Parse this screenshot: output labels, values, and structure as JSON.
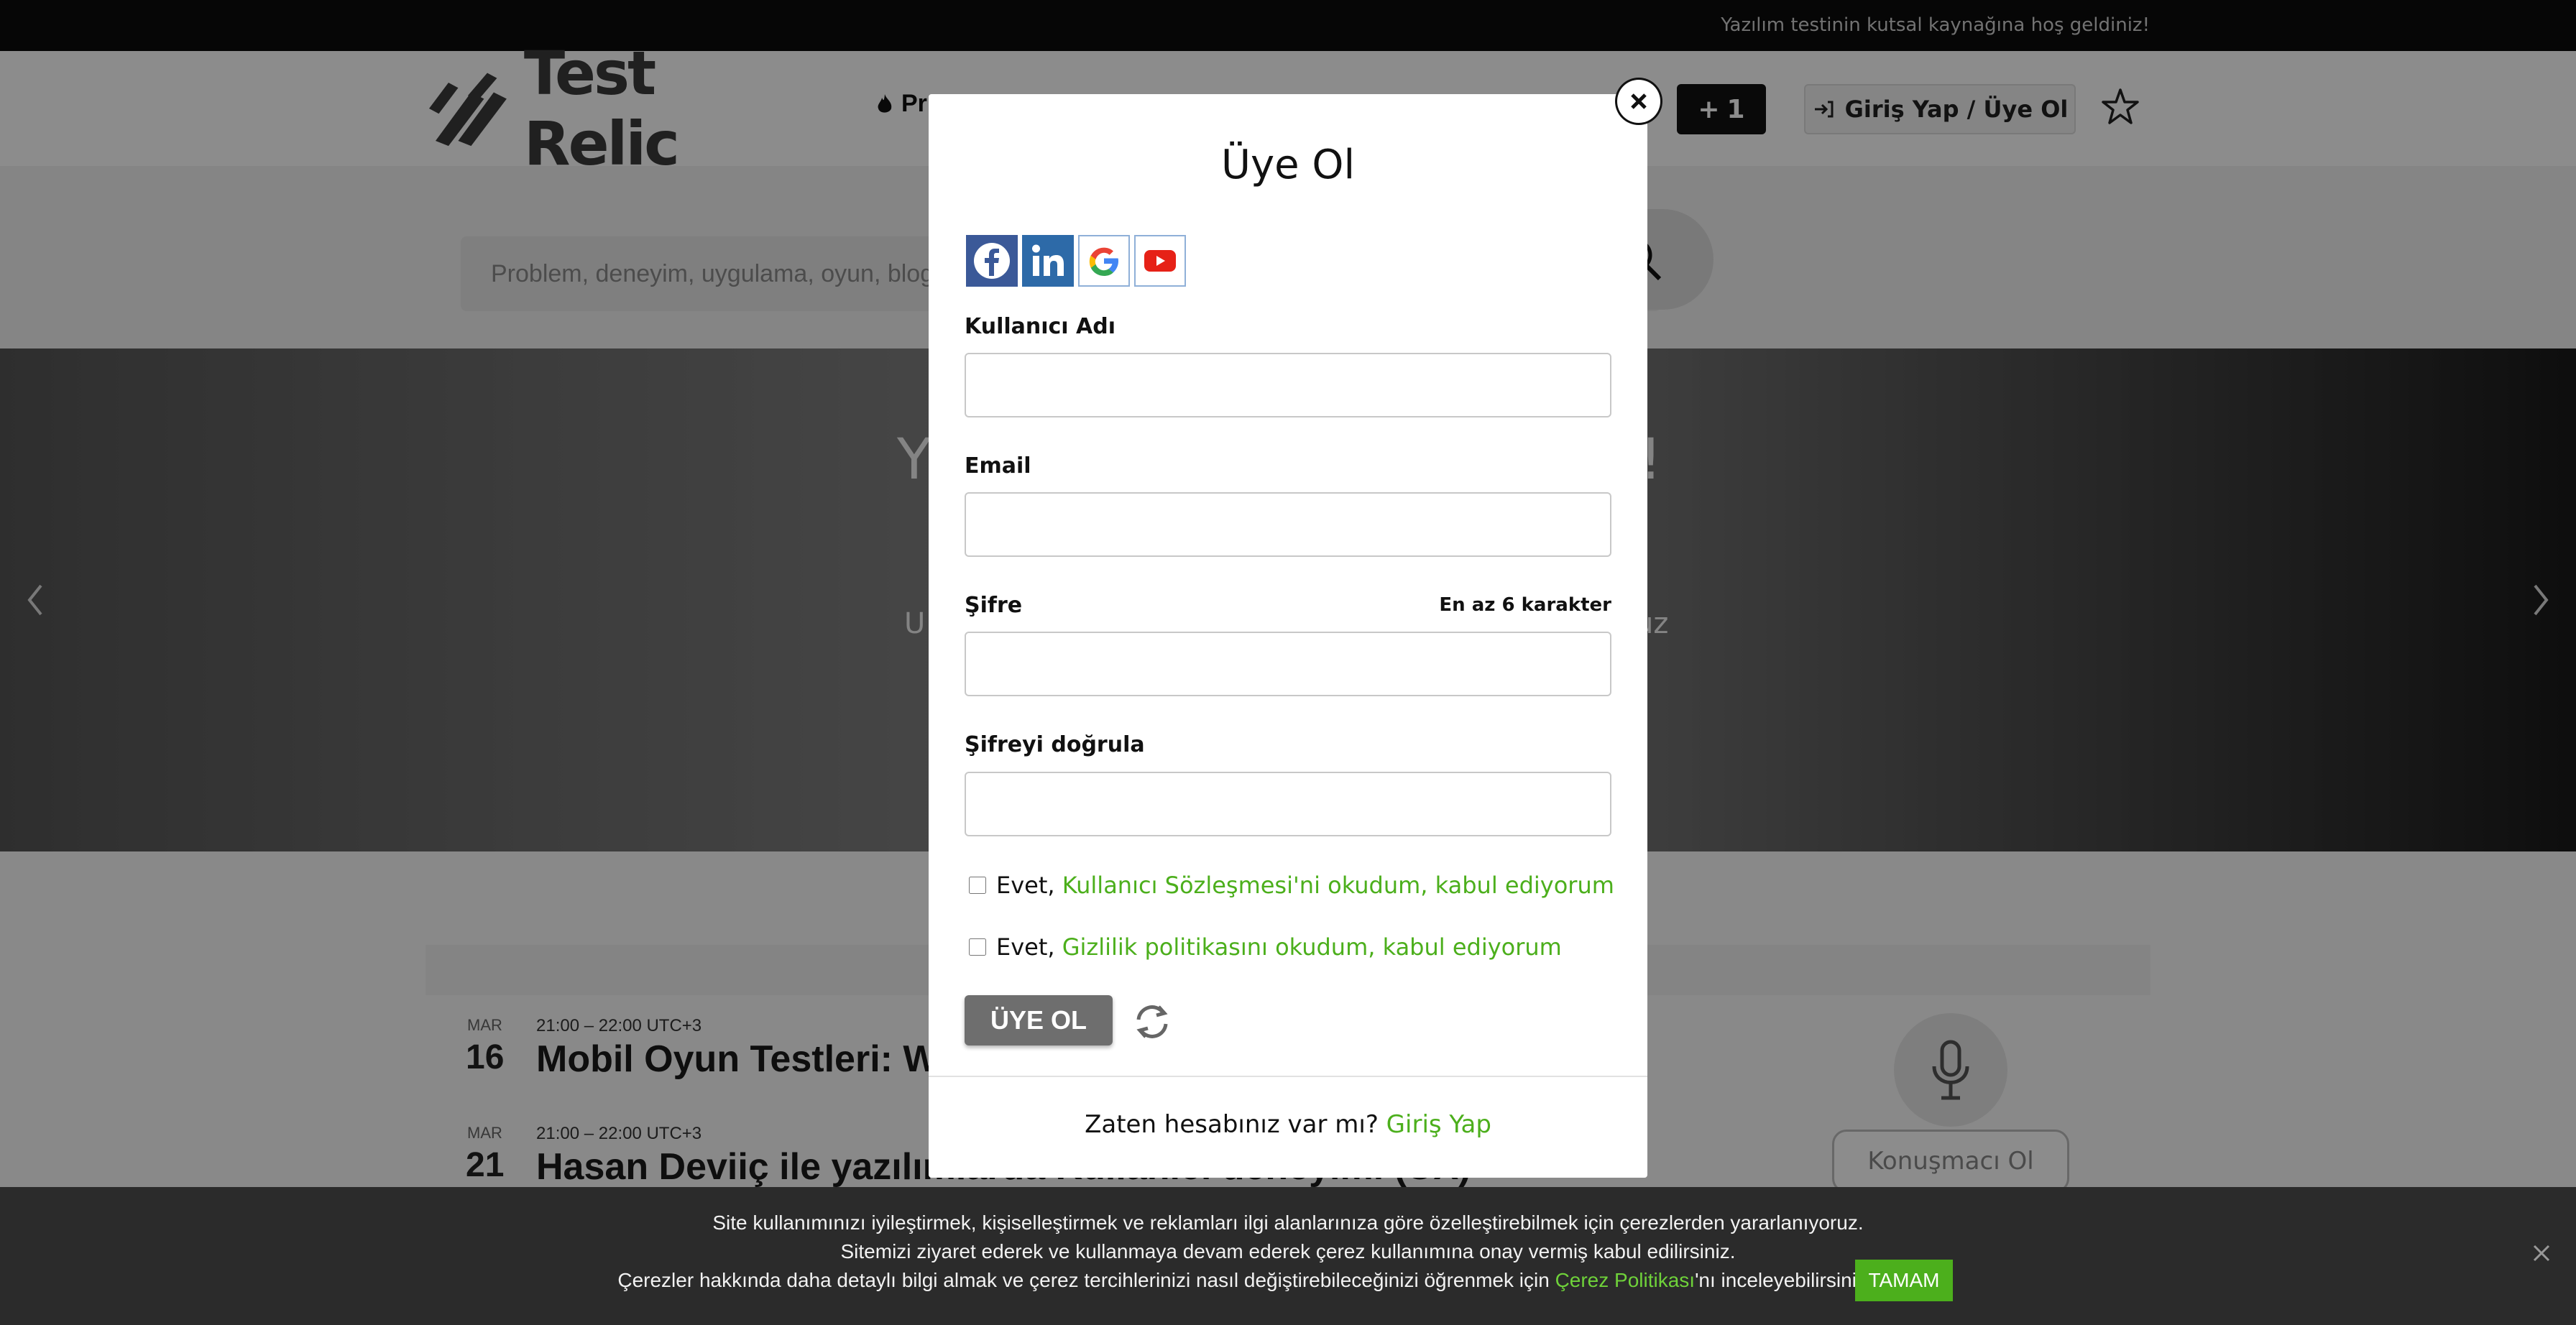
{
  "topbar": {
    "welcome": "Yazılım testinin kutsal kaynağına hoş geldiniz!"
  },
  "header": {
    "logo_text": "Test Relic",
    "nav_partial": "Pr",
    "plus_button": "1",
    "login_button": "Giriş Yap / Üye Ol"
  },
  "search": {
    "placeholder": "Problem, deneyim, uygulama, oyun, blog"
  },
  "hero": {
    "title_left": "Y",
    "title_right": "z!",
    "subtitle_left": "U",
    "subtitle_right": "uz"
  },
  "events": [
    {
      "month": "MAR",
      "day": "16",
      "time": "21:00 – 22:00 UTC+3",
      "title": "Mobil Oyun Testleri: Wor"
    },
    {
      "month": "MAR",
      "day": "21",
      "time": "21:00 – 22:00 UTC+3",
      "title": "Hasan Deviiç ile yazılımlarda Kullanıcı deneyimi (UX)"
    }
  ],
  "speaker_button": "Konuşmacı Ol",
  "modal": {
    "title": "Üye Ol",
    "username_label": "Kullanıcı Adı",
    "email_label": "Email",
    "password_label": "Şifre",
    "password_hint": "En az 6 karakter",
    "confirm_label": "Şifreyi doğrula",
    "agree_prefix": "Evet,",
    "terms_link": "Kullanıcı Sözleşmesi'ni okudum, kabul ediyorum",
    "privacy_link": "Gizlilik politikasını okudum, kabul ediyorum",
    "submit": "ÜYE OL",
    "have_account": "Zaten hesabınız var mı?",
    "login_link": "Giriş Yap"
  },
  "cookie": {
    "line1": "Site kullanımınızı iyileştirmek, kişiselleştirmek ve reklamları ilgi alanlarınıza göre özelleştirebilmek için çerezlerden yararlanıyoruz.",
    "line2": "Sitemizi ziyaret ederek ve kullanmaya devam ederek çerez kullanımına onay vermiş kabul edilirsiniz.",
    "line3_prefix": "Çerezler hakkında daha detaylı bilgi almak ve çerez tercihlerinizi nasıl değiştirebileceğinizi öğrenmek için",
    "line3_link": "Çerez Politikası",
    "line3_suffix": "'nı inceleyebilirsiniz.",
    "ok_button": "TAMAM"
  },
  "colors": {
    "accent_green": "#4caf1c",
    "topbar": "#0b0b0b",
    "cookie_bg": "#2b2b2b"
  }
}
